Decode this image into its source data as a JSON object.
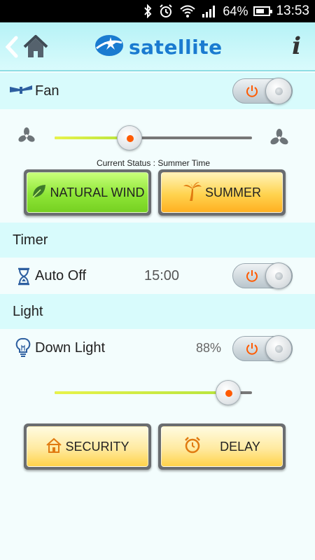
{
  "status_bar": {
    "battery_percent": "64%",
    "time": "13:53",
    "icons": [
      "bluetooth-icon",
      "alarm-icon",
      "wifi-icon",
      "signal-icon",
      "battery-icon"
    ],
    "battery_level": 0.64
  },
  "header": {
    "brand": "satellite",
    "icons": [
      "back-icon",
      "home-icon",
      "satellite-logo",
      "info-icon"
    ]
  },
  "fan": {
    "title": "Fan",
    "speed_level": 0.38,
    "status_text": "Current Status : Summer Time",
    "modes": [
      {
        "label": "NATURAL WIND",
        "icon": "leaf-icon",
        "color": "#8ee637"
      },
      {
        "label": "SUMMER",
        "icon": "palm-tree-icon",
        "color": "#ffd34f"
      }
    ]
  },
  "timer": {
    "title": "Timer",
    "auto_off_label": "Auto Off",
    "auto_off_time": "15:00"
  },
  "light": {
    "title": "Light",
    "down_light_label": "Down Light",
    "down_light_percent": "88%",
    "brightness_level": 0.88,
    "modes": [
      {
        "label": "SECURITY",
        "icon": "house-icon"
      },
      {
        "label": "DELAY",
        "icon": "alarm-clock-icon"
      }
    ]
  },
  "colors": {
    "accent": "#ff5a00",
    "brand_blue": "#1a7bd0",
    "header_bg": "#d8fbfc"
  }
}
